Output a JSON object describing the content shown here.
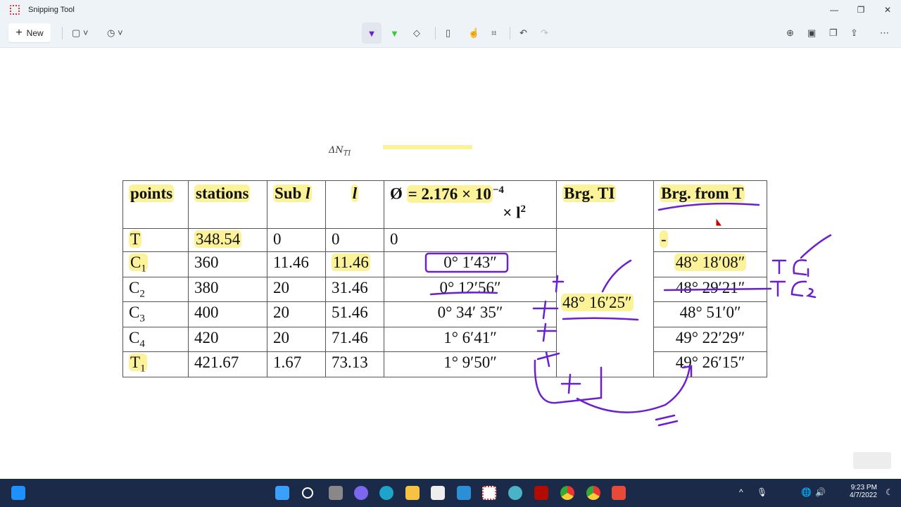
{
  "window": {
    "title": "Snipping Tool",
    "icons": [
      "snipping-tool-icon"
    ],
    "controls": [
      "minimize",
      "maximize",
      "close"
    ]
  },
  "toolbar": {
    "new_label": "New",
    "left_tools": [
      "snip-mode-icon",
      "delay-timer-icon"
    ],
    "center_tools": [
      "ballpoint-pen-icon",
      "highlighter-icon",
      "eraser-icon",
      "ruler-icon",
      "touch-writing-icon",
      "crop-icon",
      "undo-icon",
      "redo-icon"
    ],
    "right_tools": [
      "zoom-icon",
      "save-icon",
      "copy-icon",
      "share-icon",
      "more-icon"
    ]
  },
  "doc": {
    "partial_formula": "ΔN",
    "partial_formula_sub": "TI",
    "table": {
      "headers": [
        "points",
        "stations",
        "Sub ",
        "l",
        "= 2.176 × 10",
        "Brg. TI",
        "Brg. from T"
      ],
      "header_extra": {
        "sub_l": "l",
        "phi": "Ø",
        "exp": "−4",
        "times_l": "× l",
        "sq": "2"
      },
      "rows": [
        {
          "p": "T",
          "ps": "",
          "station": "348.54",
          "sub": "0",
          "l": "0",
          "phi": "0",
          "brg": "-"
        },
        {
          "p": "C",
          "ps": "1",
          "station": "360",
          "sub": "11.46",
          "l": "11.46",
          "phi": "0° 1′43″",
          "brg": "48° 18′08″"
        },
        {
          "p": "C",
          "ps": "2",
          "station": "380",
          "sub": "20",
          "l": "31.46",
          "phi": "0° 12′56″",
          "brg": "48° 29′21″"
        },
        {
          "p": "C",
          "ps": "3",
          "station": "400",
          "sub": "20",
          "l": "51.46",
          "phi": "0° 34′ 35″",
          "brg": "48° 51′0″"
        },
        {
          "p": "C",
          "ps": "4",
          "station": "420",
          "sub": "20",
          "l": "71.46",
          "phi": "1° 6′41″",
          "brg": "49° 22′29″"
        },
        {
          "p": "T",
          "ps": "1",
          "station": "421.67",
          "sub": "1.67",
          "l": "73.13",
          "phi": "1° 9′50″",
          "brg": "49° 26′15″"
        }
      ],
      "brg_ti": "48° 16′25″"
    },
    "ink_color": "#6a1fd0",
    "highlight_color": "#fcf29a"
  },
  "taskbar": {
    "time": "9:23 PM",
    "date": "4/7/2022",
    "apps": [
      "start-icon",
      "search-icon",
      "task-view-icon",
      "teams-icon",
      "edge-icon",
      "file-explorer-icon",
      "store-icon",
      "mail-icon",
      "snipping-tool-icon",
      "paint-icon",
      "acrobat-icon",
      "chrome-icon",
      "chrome-profile-icon",
      "app-s-icon"
    ]
  }
}
